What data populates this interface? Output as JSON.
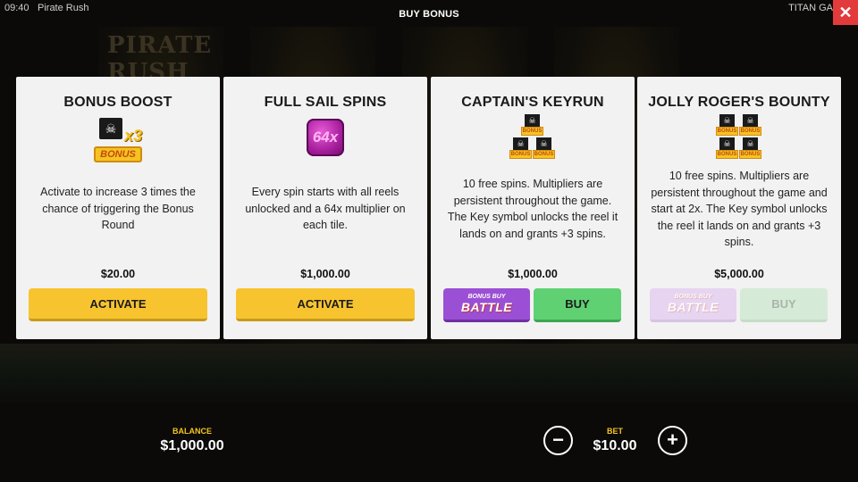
{
  "topbar": {
    "clock": "09:40",
    "game_name": "Pirate Rush",
    "title": "BUY BONUS",
    "brand": "TITAN GA",
    "close_icon": "close-icon",
    "close_glyph": "✕"
  },
  "background": {
    "logo_text": "PIRATE RUSH"
  },
  "cards": [
    {
      "title": "BONUS BOOST",
      "icon": "bonus-x3-icon",
      "icon_texts": {
        "multiplier": "x3",
        "label": "BONUS"
      },
      "description": "Activate to increase 3 times the chance of triggering the Bonus Round",
      "price": "$20.00",
      "action_label": "ACTIVATE"
    },
    {
      "title": "FULL SAIL SPINS",
      "icon": "multiplier-64x-icon",
      "icon_texts": {
        "multiplier": "64x"
      },
      "description": "Every spin starts with all reels unlocked and a 64x multiplier on each tile.",
      "price": "$1,000.00",
      "action_label": "ACTIVATE"
    },
    {
      "title": "CAPTAIN'S KEYRUN",
      "icon": "triple-bonus-icon",
      "icon_texts": {
        "label": "BONUS"
      },
      "description": "10 free spins. Multipliers are persistent throughout the game. The Key symbol unlocks the reel it lands on and grants +3 spins.",
      "price": "$1,000.00",
      "battle_label_top": "BONUS BUY",
      "battle_label_main": "BATTLE",
      "buy_label": "BUY",
      "enabled": true
    },
    {
      "title": "JOLLY ROGER'S BOUNTY",
      "icon": "quad-bonus-icon",
      "icon_texts": {
        "label": "BONUS"
      },
      "description": "10 free spins. Multipliers are persistent throughout the game and start at 2x. The Key symbol unlocks the reel it lands on and grants +3 spins.",
      "price": "$5,000.00",
      "battle_label_top": "BONUS BUY",
      "battle_label_main": "BATTLE",
      "buy_label": "BUY",
      "enabled": false
    }
  ],
  "footer": {
    "balance_label": "BALANCE",
    "balance_value": "$1,000.00",
    "bet_label": "BET",
    "bet_value": "$10.00",
    "minus_icon": "minus-icon",
    "minus_glyph": "−",
    "plus_icon": "plus-icon",
    "plus_glyph": "+"
  },
  "colors": {
    "accent_yellow": "#f7c42f",
    "buy_green": "#5fd173",
    "battle_purple": "#9a4fd4",
    "close_red": "#e33b3b",
    "label_gold": "#f5c321"
  }
}
